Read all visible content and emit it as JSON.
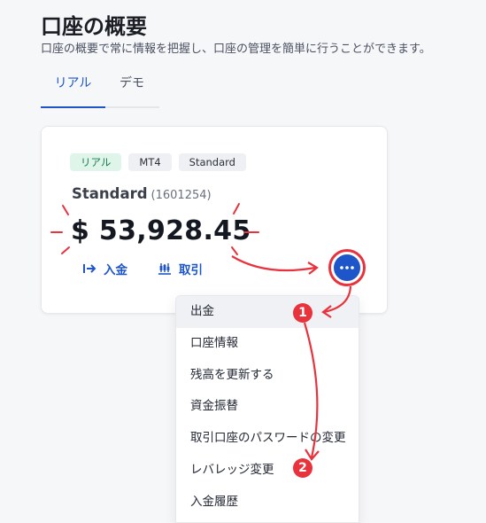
{
  "header": {
    "title": "口座の概要",
    "subtitle": "口座の概要で常に情報を把握し、口座の管理を簡単に行うことができます。"
  },
  "tabs": [
    {
      "label": "リアル",
      "active": true
    },
    {
      "label": "デモ",
      "active": false
    }
  ],
  "account_card": {
    "badges": [
      "リアル",
      "MT4",
      "Standard"
    ],
    "name": "Standard",
    "id": "(1601254)",
    "balance": "$ 53,928.45",
    "actions": {
      "deposit": "入金",
      "trade": "取引"
    }
  },
  "menu": {
    "items": [
      "出金",
      "口座情報",
      "残高を更新する",
      "資金振替",
      "取引口座のパスワードの変更",
      "レバレッジ変更",
      "入金履歴"
    ]
  },
  "annotations": {
    "step_1": "1",
    "step_2": "2"
  },
  "colors": {
    "accent": "#1e56c9",
    "annotation_red": "#e8323c",
    "real_badge_bg": "#dff5e9"
  }
}
